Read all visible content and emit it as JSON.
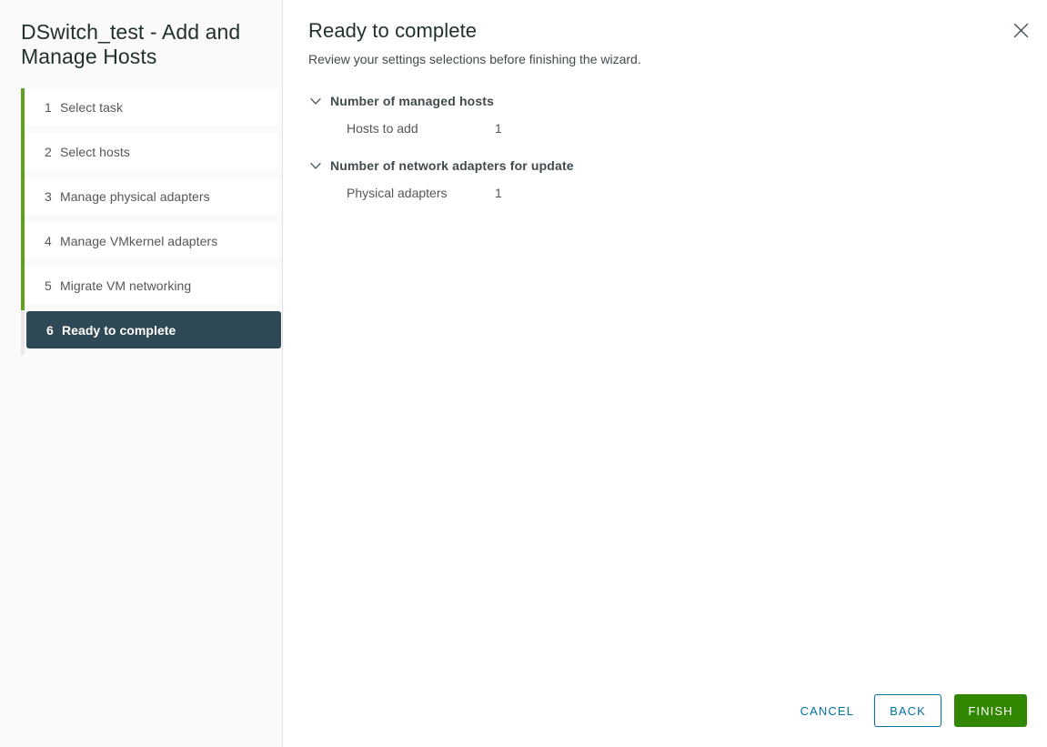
{
  "sidebar": {
    "wizard_title": "DSwitch_test - Add and Manage Hosts",
    "steps": [
      {
        "number": "1",
        "label": "Select task",
        "state": "completed"
      },
      {
        "number": "2",
        "label": "Select hosts",
        "state": "completed"
      },
      {
        "number": "3",
        "label": "Manage physical adapters",
        "state": "completed"
      },
      {
        "number": "4",
        "label": "Manage VMkernel adapters",
        "state": "completed"
      },
      {
        "number": "5",
        "label": "Migrate VM networking",
        "state": "completed"
      },
      {
        "number": "6",
        "label": "Ready to complete",
        "state": "active"
      }
    ]
  },
  "main": {
    "title": "Ready to complete",
    "subtitle": "Review your settings selections before finishing the wizard.",
    "close_icon": "close-icon",
    "sections": [
      {
        "title": "Number of managed hosts",
        "expanded": true,
        "chevron_icon": "chevron-down-icon",
        "rows": [
          {
            "key": "Hosts to add",
            "value": "1"
          }
        ]
      },
      {
        "title": "Number of network adapters for update",
        "expanded": true,
        "chevron_icon": "chevron-down-icon",
        "rows": [
          {
            "key": "Physical adapters",
            "value": "1"
          }
        ]
      }
    ]
  },
  "footer": {
    "cancel_label": "CANCEL",
    "back_label": "BACK",
    "finish_label": "FINISH"
  },
  "colors": {
    "completed_rail": "#5aa220",
    "active_step_bg": "#2f4856",
    "sidebar_bg": "#fafafa",
    "link_blue": "#0072a3",
    "finish_green": "#318700",
    "text_gray": "#565656",
    "heading_dark": "#21312f"
  }
}
